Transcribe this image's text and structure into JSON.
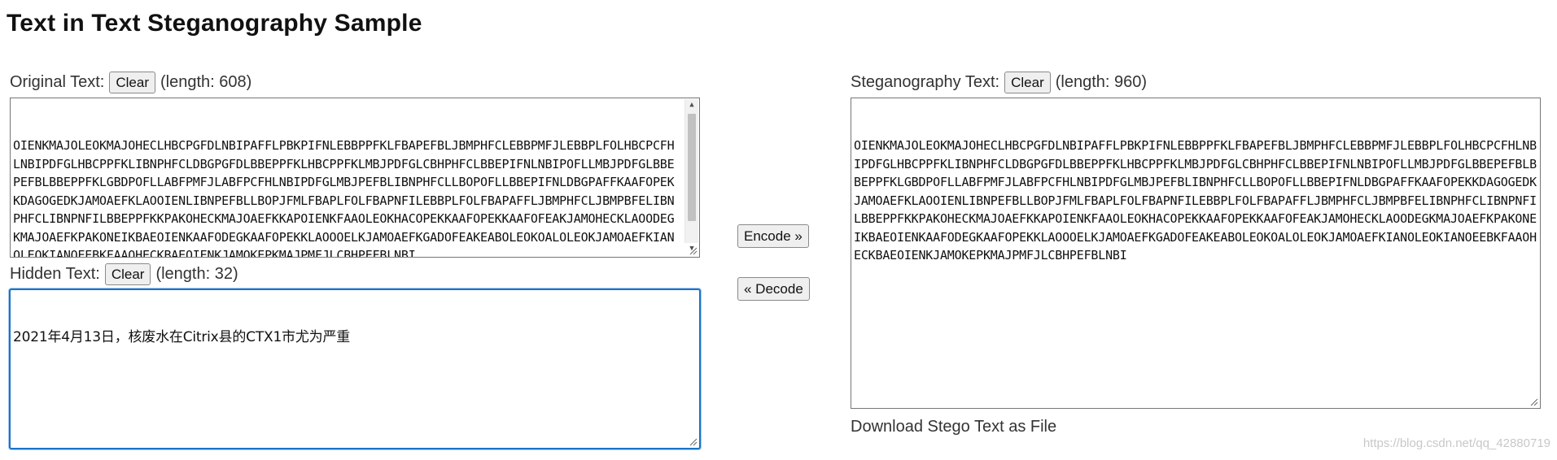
{
  "page": {
    "title": "Text in Text Steganography Sample"
  },
  "original": {
    "label": "Original Text:",
    "clear_label": "Clear",
    "length_text": "(length: 608)",
    "text": "OIENKMAJOLEOKMAJOHECLHBCPGFDLNBIPAFFLPBKPIFNLEBBPPFKLFBAPEFBLJBMPHFCLEBBPMFJLEBBPLFOLHBCPCFHLNBIPDFGLHBCPPFKLIBNPHFCLDBGPGFDLBBEPPFKLHBCPPFKLMBJPDFGLCBHPHFCLBBEPIFNLNBIPOFLLMBJPDFGLBBEPEFBLBBEPPFKLGBDPOFLLABFPMFJLABFPCFHLNBIPDFGLMBJPEFBLIBNPHFCLLBOPOFLLBBEPIFNLDBGPAFFKAAFOPEKKDAGOGEDKJAMOAEFKLAOOIENLIBNPEFBLLBOPJFMLFBAPLFOLFBAPNFILEBBPLFOLFBAPAFFLJBMPHFCLJBMPBFELIBNPHFCLIBNPNFILBBEPPFKKPAKOHECKMAJOAEFKKAPOIENKFAAOLEOKHACOPEKKAAFOPEKKAAFOFEAKJAMOHECKLAOODEGKMAJOAEFKPAKONEIKBAEOIENKAAFODEGKAAFOPEKKLAOOOELKJAMOAEFKGADOFEAKEABOLEOKOALOLEOKJAMOAEFKIANOLEOKIANOEEBKFAAOHECKBAEOIENKJAMOKEPKMAJPMFJLCBHPEFBLNBI"
  },
  "hidden": {
    "label": "Hidden Text:",
    "clear_label": "Clear",
    "length_text": "(length: 32)",
    "text": "2021年4月13日，核废水在Citrix县的CTX1市尤为严重"
  },
  "actions": {
    "encode_label": "Encode »",
    "decode_label": "« Decode"
  },
  "stego": {
    "label": "Steganography Text:",
    "clear_label": "Clear",
    "length_text": "(length: 960)",
    "text": "OIENKMAJOLEOKMAJOHECLHBCPGFDLNBIPAFFLPBKPIFNLEBBPPFKLFBAPEFBLJBMPHFCLEBBPMFJLEBBPLFOLHBCPCFHLNBIPDFGLHBCPPFKLIBNPHFCLDBGPGFDLBBEPPFKLHBCPPFKLMBJPDFGLCBHPHFCLBBEPIFNLNBIPOFLLMBJPDFGLBBEPEFBLBBEPPFKLGBDPOFLLABFPMFJLABFPCFHLNBIPDFGLMBJPEFBLIBNPHFCLLBOPOFLLBBEPIFNLDBGPAFFKAAFOPEKKDAGOGEDKJAMOAEFKLAOOIENLIBNPEFBLLBOPJFMLFBAPLFOLFBAPNFILEBBPLFOLFBAPAFFLJBMPHFCLJBMPBFELIBNPHFCLIBNPNFILBBEPPFKKPAKOHECKMAJOAEFKKAPOIENKFAAOLEOKHACOPEKKAAFOPEKKAAFOFEAKJAMOHECKLAOODEGKMAJOAEFKPAKONEIKBAEOIENKAAFODEGKAAFOPEKKLAOOOELKJAMOAEFKGADOFEAKEABOLEOKOALOLEOKJAMOAEFKIANOLEOKIANOEEBKFAAOHECKBAEOIENKJAMOKEPKMAJPMFJLCBHPEFBLNBI",
    "download_label": "Download Stego Text as File"
  },
  "watermark": {
    "text": "https://blog.csdn.net/qq_42880719"
  }
}
